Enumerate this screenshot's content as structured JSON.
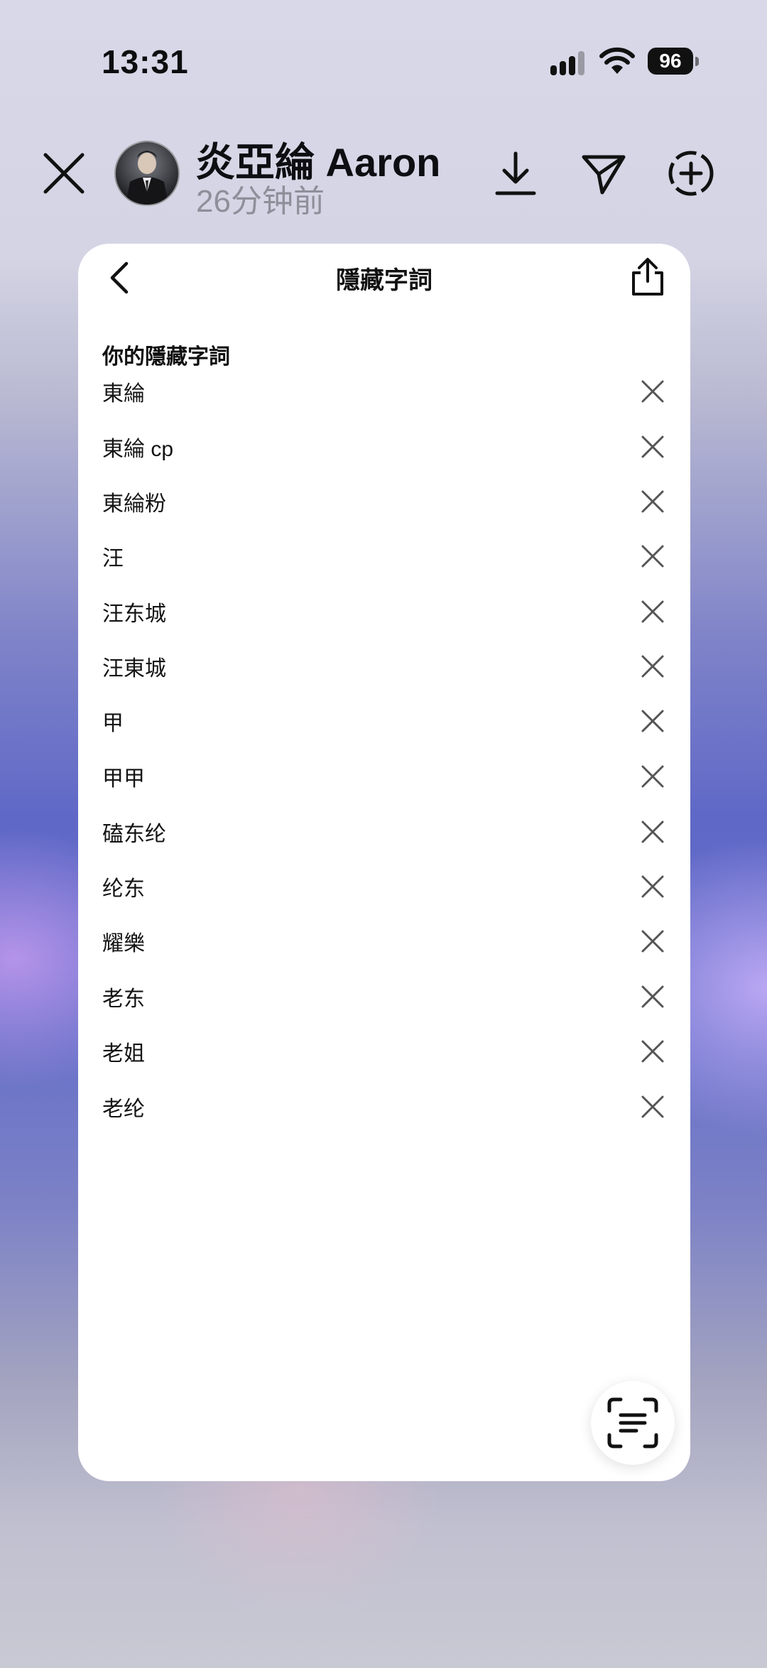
{
  "status_bar": {
    "time": "13:31",
    "battery": "96"
  },
  "story": {
    "user_name": "炎亞綸 Aaron",
    "time_ago": "26分钟前"
  },
  "panel": {
    "title": "隱藏字詞",
    "section_label": "你的隱藏字詞",
    "words": [
      "東綸",
      "東綸 cp",
      "東綸粉",
      "汪",
      "汪东城",
      "汪東城",
      "甲",
      "甲甲",
      "磕东纶",
      "纶东",
      "耀樂",
      "老东",
      "老姐",
      "老纶"
    ]
  },
  "icons": {
    "close": "close-icon",
    "download": "download-icon",
    "send": "send-icon",
    "add": "add-circle-icon",
    "back": "chevron-left-icon",
    "share": "share-icon",
    "delete": "x-icon",
    "scan": "text-scan-icon"
  }
}
